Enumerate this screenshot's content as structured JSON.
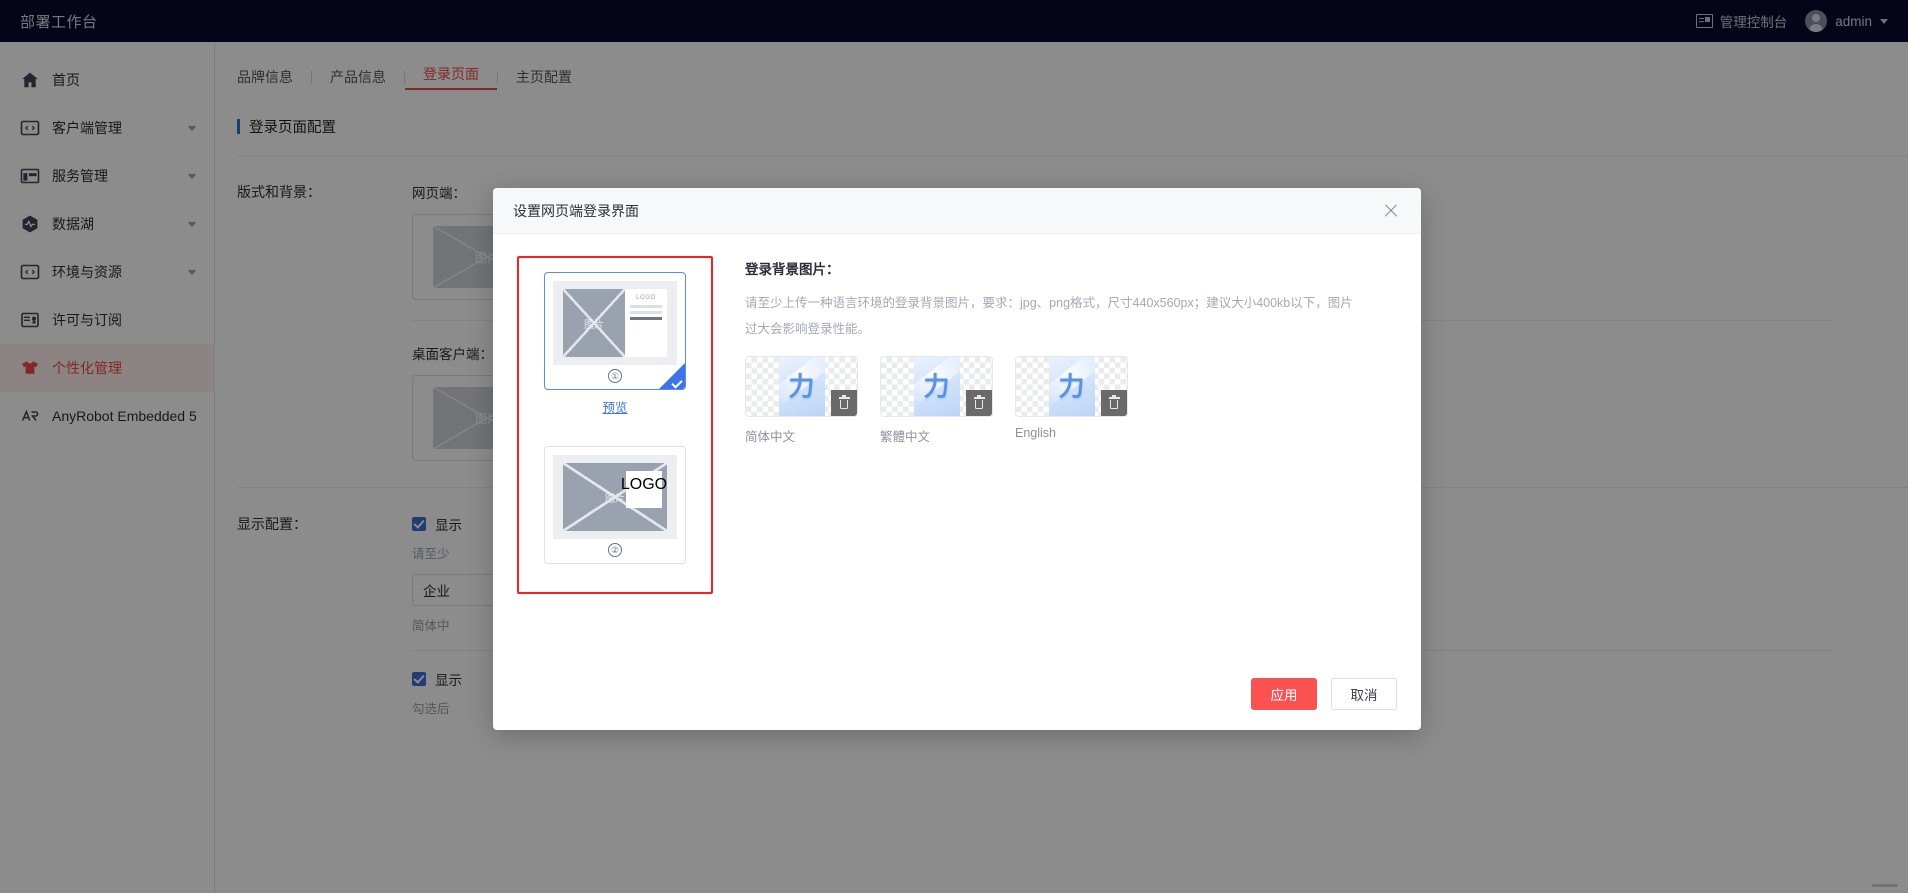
{
  "topbar": {
    "title": "部署工作台",
    "console_label": "管理控制台",
    "console_icon": "console-icon",
    "user_name": "admin",
    "caret_icon": "chevron-down-icon"
  },
  "sidebar": {
    "items": [
      {
        "label": "首页",
        "icon": "home-icon",
        "expandable": false,
        "active": false
      },
      {
        "label": "客户端管理",
        "icon": "code-window-icon",
        "expandable": true,
        "active": false
      },
      {
        "label": "服务管理",
        "icon": "layout-panels-icon",
        "expandable": true,
        "active": false
      },
      {
        "label": "数据湖",
        "icon": "hexagon-pulse-icon",
        "expandable": true,
        "active": false
      },
      {
        "label": "环境与资源",
        "icon": "code-window-icon",
        "expandable": true,
        "active": false
      },
      {
        "label": "许可与订阅",
        "icon": "certificate-icon",
        "expandable": false,
        "active": false
      },
      {
        "label": "个性化管理",
        "icon": "tshirt-icon",
        "expandable": false,
        "active": true
      },
      {
        "label": "AnyRobot Embedded 5",
        "icon": "anyrobot-icon",
        "expandable": false,
        "active": false
      }
    ]
  },
  "content": {
    "tabs": [
      {
        "label": "品牌信息",
        "active": false
      },
      {
        "label": "产品信息",
        "active": false
      },
      {
        "label": "登录页面",
        "active": true
      },
      {
        "label": "主页配置",
        "active": false
      }
    ],
    "section_title": "登录页面配置",
    "rows": [
      {
        "label": "版式和背景：",
        "sub_label_web": "网页端：",
        "sub_label_desktop": "桌面客户端：",
        "placeholder_text": "图片"
      },
      {
        "label": "显示配置：",
        "check1": "显示",
        "hint1": "请至少",
        "input_value": "企业",
        "hint2": "简体中",
        "check2": "显示",
        "hint3": "勾选后"
      }
    ]
  },
  "modal": {
    "title": "设置网页端登录界面",
    "close_icon": "close-icon",
    "layouts": [
      {
        "number": "①",
        "selected": true,
        "image_label": "图片",
        "logo_label": "LOGO",
        "preview_link": "预览"
      },
      {
        "number": "②",
        "selected": false,
        "image_label": "图片",
        "logo_label": "LOGO"
      }
    ],
    "background": {
      "heading": "登录背景图片：",
      "description": "请至少上传一种语言环境的登录背景图片，要求：jpg、png格式，尺寸440x560px；建议大小400kb以下，图片过大会影响登录性能。",
      "images": [
        {
          "caption": "简体中文",
          "glyph": "力",
          "delete_icon": "trash-icon"
        },
        {
          "caption": "繁體中文",
          "glyph": "力",
          "delete_icon": "trash-icon"
        },
        {
          "caption": "English",
          "glyph": "力",
          "delete_icon": "trash-icon"
        }
      ]
    },
    "footer": {
      "apply_label": "应用",
      "cancel_label": "取消"
    }
  },
  "colors": {
    "topbar_bg": "#0a0a2e",
    "accent_red": "#ef4a45",
    "primary_button": "#fa5251",
    "link_blue": "#3f74e8",
    "highlight_border": "#fb1f1f",
    "section_bar": "#2f6fd0"
  }
}
